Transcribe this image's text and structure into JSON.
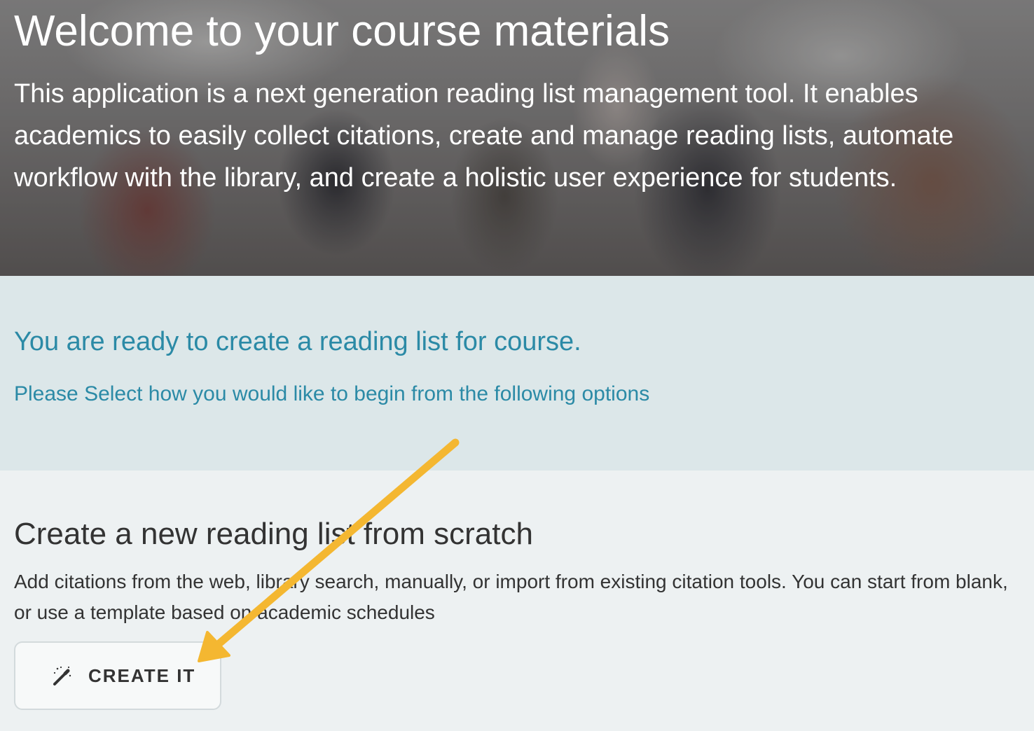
{
  "hero": {
    "title": "Welcome to your course materials",
    "description": "This application is a next generation reading list management tool. It enables academics to easily collect citations, create and manage reading lists, automate workflow with the library, and create a holistic user experience for students."
  },
  "ready": {
    "heading": "You are ready to create a reading list for course.",
    "subheading": "Please Select how you would like to begin from the following options"
  },
  "create": {
    "heading": "Create a new reading list from scratch",
    "description": "Add citations from the web, library search, manually, or import from existing citation tools. You can start from blank, or use a template based on academic schedules",
    "button_label": "CREATE IT",
    "button_icon": "magic-wand-icon"
  },
  "colors": {
    "accent": "#2b8aa6",
    "annotation_arrow": "#f4b731"
  }
}
